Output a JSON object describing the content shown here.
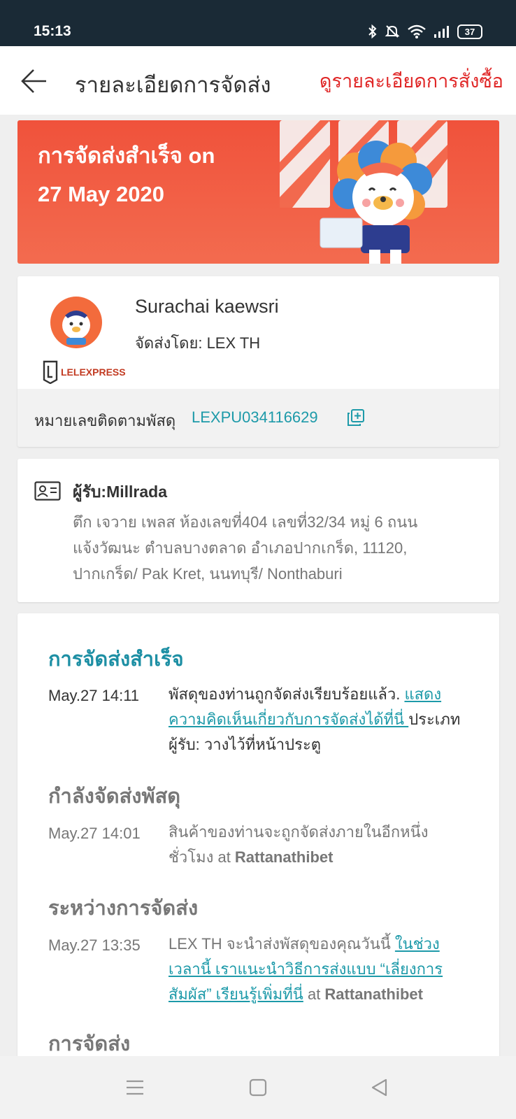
{
  "status_bar": {
    "time": "15:13",
    "battery": "37"
  },
  "header": {
    "title": "รายละเอียดการจัดส่ง",
    "order_link": "ดูรายละเอียดการสั่งซื้อ"
  },
  "banner": {
    "line1": "การจัดส่งสำเร็จ on",
    "line2": "27 May 2020"
  },
  "courier": {
    "recipient_name": "Surachai kaewsri",
    "shipped_by": "จัดส่งโดย: LEX TH",
    "logo_text": "LELEXPRESS",
    "tracking_label": "หมายเลขติดตามพัสดุ",
    "tracking_number": "LEXPU034116629"
  },
  "address": {
    "name": "ผู้รับ:Millrada",
    "line1": "ตึก เจวาย เพลส ห้องเลขที่404 เลขที่32/34 หมู่ 6 ถนน",
    "line2": "แจ้งวัฒนะ ตำบลบางตลาด อำเภอปากเกร็ด, 11120,",
    "line3": "ปากเกร็ด/ Pak Kret, นนทบุรี/ Nonthaburi"
  },
  "timeline": {
    "stages": [
      {
        "title": "การจัดส่งสำเร็จ",
        "time": "May.27 14:11",
        "text_before": "พัสดุของท่านถูกจัดส่งเรียบร้อยแล้ว. ",
        "link": "แสดงความคิดเห็นเกี่ยวกับการจัดส่งได้ที่นี่ ",
        "text_after": "ประเภทผู้รับ: วางไว้ที่หน้าประตู"
      },
      {
        "title": "กำลังจัดส่งพัสดุ",
        "time": "May.27 14:01",
        "text_before": "สินค้าของท่านจะถูกจัดส่งภายในอีกหนึ่งชั่วโมง at ",
        "location": "Rattanathibet"
      },
      {
        "title": "ระหว่างการจัดส่ง",
        "time": "May.27 13:35",
        "text_before": "LEX TH จะนำส่งพัสดุของคุณวันนี้ ",
        "link": "ในช่วงเวลานี้ เราแนะนำวิธีการส่งแบบ “เลี่ยงการสัมผัส” เรียนรู้เพิ่มที่นี่",
        "text_after": " at ",
        "location": "Rattanathibet"
      },
      {
        "title": "การจัดส่ง"
      }
    ]
  },
  "colors": {
    "accent": "#1d8fa4",
    "brand_red": "#e02727",
    "banner": "#f0523b"
  }
}
